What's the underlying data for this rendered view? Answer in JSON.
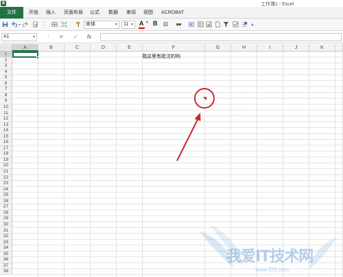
{
  "app": {
    "window_title": "工作簿1 - Excel",
    "icon_glyph": "X"
  },
  "ribbon": {
    "file_tab": "文件",
    "tabs": [
      "开始",
      "插入",
      "页面布局",
      "公式",
      "数据",
      "审阅",
      "视图",
      "ACROBAT"
    ]
  },
  "toolbar": {
    "font_name": "宋体",
    "font_size": "11",
    "bold_label": "B",
    "font_color_letter": "A",
    "font_color": "#e00000"
  },
  "formula_bar": {
    "name_box": "A1",
    "cancel_symbol": "✕",
    "enter_symbol": "✓",
    "fx_label": "fx",
    "value": ""
  },
  "sheet": {
    "columns": [
      "A",
      "B",
      "C",
      "D",
      "E",
      "F",
      "G",
      "H",
      "I",
      "J",
      "K"
    ],
    "rows": [
      "1",
      "2",
      "3",
      "4",
      "5",
      "6",
      "7",
      "8",
      "9",
      "10",
      "11",
      "12",
      "13",
      "14",
      "15",
      "16",
      "17",
      "18",
      "19",
      "20",
      "21",
      "22",
      "23",
      "24",
      "25",
      "26",
      "27",
      "28",
      "29",
      "30",
      "31",
      "32",
      "33",
      "34",
      "35",
      "36",
      "37",
      "38"
    ],
    "selected_column": "A",
    "selected_row": "1",
    "cell_F7": "我这里有批注的哟"
  },
  "annotation": {
    "color": "#c8282c"
  },
  "watermark": {
    "text": "我爱IT技术网",
    "url": "www.52ij.com"
  },
  "colors": {
    "accent": "#217346"
  }
}
